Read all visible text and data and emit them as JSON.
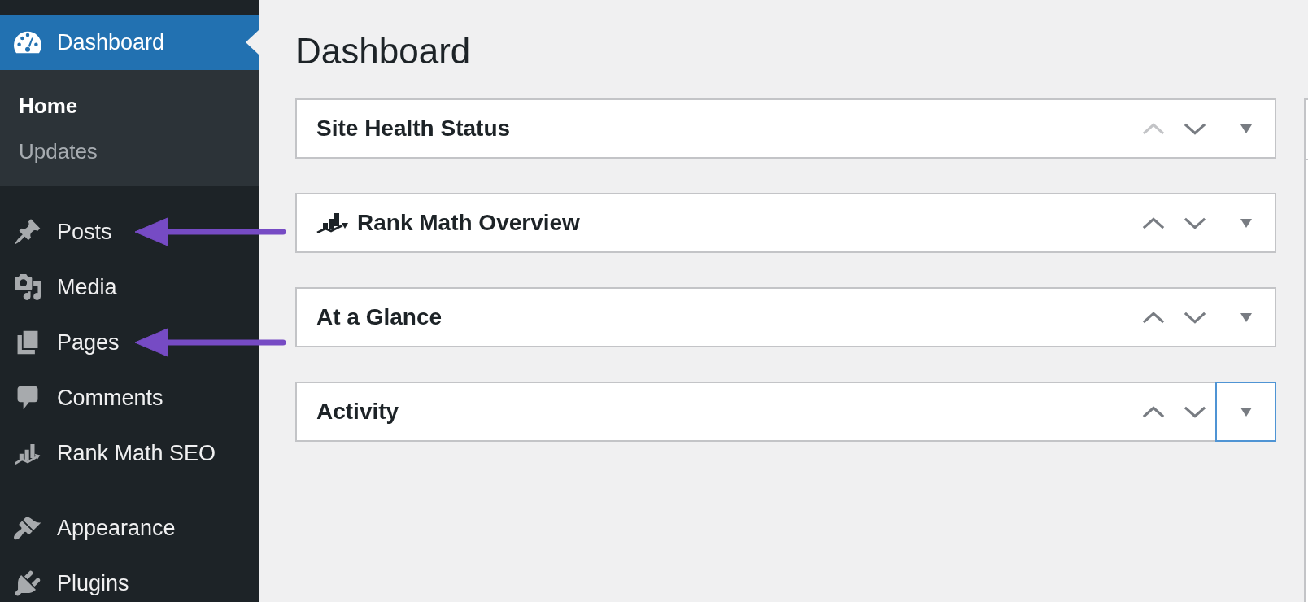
{
  "sidebar": {
    "menu_groups": [
      {
        "items": [
          {
            "label": "Dashboard",
            "selected": true,
            "annotated": false,
            "submenu": [
              {
                "label": "Home",
                "selected": true
              },
              {
                "label": "Updates",
                "selected": false
              }
            ]
          },
          {
            "label": "Posts",
            "selected": false,
            "annotated": true
          },
          {
            "label": "Media",
            "selected": false,
            "annotated": false
          },
          {
            "label": "Pages",
            "selected": false,
            "annotated": true
          },
          {
            "label": "Comments",
            "selected": false,
            "annotated": false
          },
          {
            "label": "Rank Math SEO",
            "selected": false,
            "annotated": false
          }
        ]
      },
      {
        "items": [
          {
            "label": "Appearance",
            "selected": false,
            "annotated": false
          },
          {
            "label": "Plugins",
            "selected": false,
            "annotated": false
          }
        ]
      }
    ]
  },
  "main": {
    "page_title": "Dashboard",
    "panels": [
      {
        "title": "Site Health Status",
        "kind": "plain",
        "up_disabled": true,
        "down_disabled": false,
        "toggle_focused": false
      },
      {
        "title": "Rank Math Overview",
        "kind": "logo",
        "up_disabled": false,
        "down_disabled": false,
        "toggle_focused": false
      },
      {
        "title": "At a Glance",
        "kind": "plain",
        "up_disabled": false,
        "down_disabled": false,
        "toggle_focused": false
      },
      {
        "title": "Activity",
        "kind": "plain",
        "up_disabled": false,
        "down_disabled": false,
        "toggle_focused": true
      }
    ]
  }
}
